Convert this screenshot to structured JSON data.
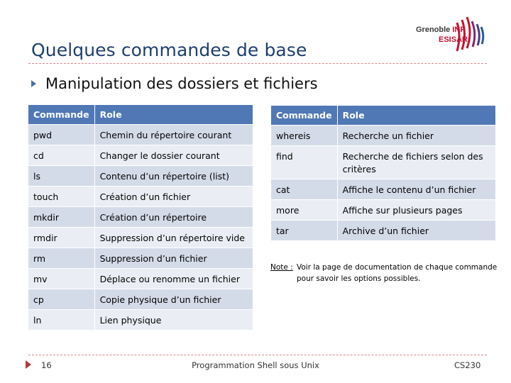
{
  "slide": {
    "title": "Quelques commandes de base",
    "bullet": "Manipulation des dossiers et fichiers"
  },
  "logo": {
    "line1": "Grenoble",
    "line1_accent": "INP",
    "line2": "ESISAR"
  },
  "table_left": {
    "headers": [
      "Commande",
      "Role"
    ],
    "rows": [
      [
        "pwd",
        "Chemin du répertoire courant"
      ],
      [
        "cd",
        "Changer le dossier courant"
      ],
      [
        "ls",
        "Contenu d’un répertoire (list)"
      ],
      [
        "touch",
        "Création d’un fichier"
      ],
      [
        "mkdir",
        "Création d’un répertoire"
      ],
      [
        "rmdir",
        "Suppression d’un répertoire vide"
      ],
      [
        "rm",
        "Suppression d’un fichier"
      ],
      [
        "mv",
        "Déplace ou renomme un fichier"
      ],
      [
        "cp",
        "Copie physique d’un fichier"
      ],
      [
        "ln",
        "Lien physique"
      ]
    ]
  },
  "table_right": {
    "headers": [
      "Commande",
      "Role"
    ],
    "rows": [
      [
        "whereis",
        "Recherche un fichier"
      ],
      [
        "find",
        "Recherche de fichiers selon des critères"
      ],
      [
        "cat",
        "Affiche le contenu d’un fichier"
      ],
      [
        "more",
        "Affiche sur plusieurs pages"
      ],
      [
        "tar",
        "Archive d’un fichier"
      ]
    ]
  },
  "note": {
    "label": "Note :",
    "text": "Voir la page de documentation de chaque commande pour savoir les options possibles."
  },
  "footer": {
    "page_number": "16",
    "course": "Programmation Shell sous Unix",
    "code": "CS230"
  },
  "colors": {
    "title": "#1f3f6e",
    "table_header": "#4f78b5",
    "row_odd": "#d4dbe8",
    "row_even": "#eaeef4",
    "rule": "#d48a8a",
    "logo_red": "#c4122f"
  }
}
